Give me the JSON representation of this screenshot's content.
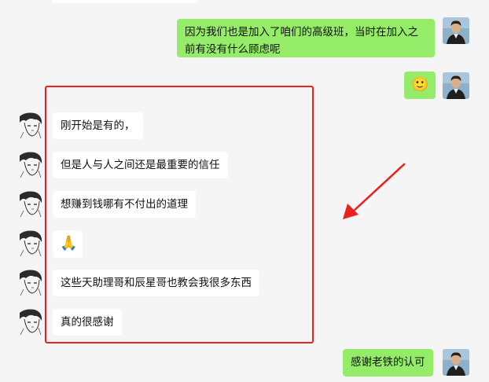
{
  "messages": {
    "m1": "因为我们也是加入了咱们的高级班，当时在加入之前有没有什么顾虑呢",
    "m2_emoji": "🙂",
    "m3": "刚开始是有的，",
    "m4": "但是人与人之间还是最重要的信任",
    "m5": "想赚到钱哪有不付出的道理",
    "m6_emoji": "🙏",
    "m7": "这些天助理哥和辰星哥也教会我很多东西",
    "m8": "真的很感谢",
    "m9": "感谢老铁的认可"
  },
  "colors": {
    "background": "#f5f5f5",
    "bubble_self": "#95ec69",
    "bubble_other": "#ffffff",
    "annotation": "#e8221d"
  },
  "icons": {
    "self_avatar": "man-in-suit-avatar",
    "other_avatar": "manga-sketch-avatar",
    "annotation_arrow": "red-arrow-icon"
  }
}
